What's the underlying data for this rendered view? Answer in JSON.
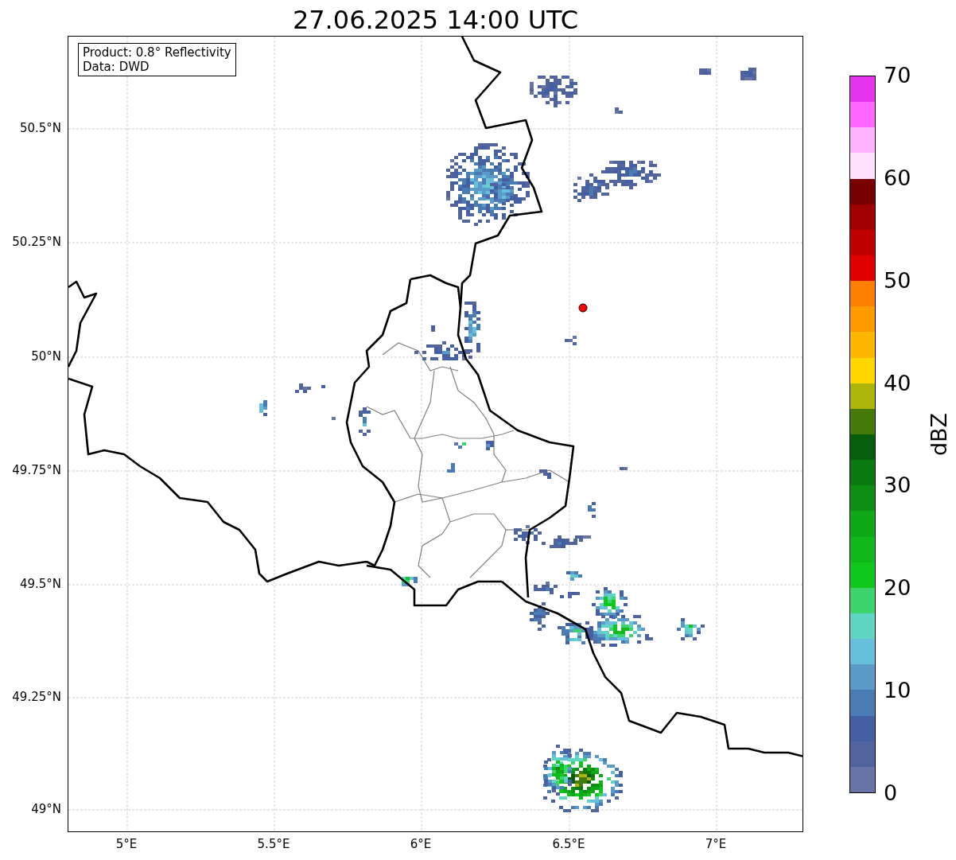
{
  "title": "27.06.2025 14:00 UTC",
  "info_box": [
    "Product: 0.8° Reflectivity",
    "Data: DWD"
  ],
  "map": {
    "lat_labels": [
      "50.5°N",
      "50.25°N",
      "50°N",
      "49.75°N",
      "49.5°N",
      "49.25°N",
      "49°N"
    ],
    "lon_labels": [
      "5°E",
      "5.5°E",
      "6°E",
      "6.5°E",
      "7°E"
    ]
  },
  "colorbar": {
    "label": "dBZ",
    "ticks": [
      "70",
      "60",
      "50",
      "40",
      "30",
      "20",
      "10",
      "0"
    ],
    "bands": [
      {
        "color": "#6674a8"
      },
      {
        "color": "#52649e"
      },
      {
        "color": "#4460a3"
      },
      {
        "color": "#4a7bb3"
      },
      {
        "color": "#5a9bc8"
      },
      {
        "color": "#66c0dc"
      },
      {
        "color": "#5fd6c4"
      },
      {
        "color": "#3dd46e"
      },
      {
        "color": "#10c81b"
      },
      {
        "color": "#10b81a"
      },
      {
        "color": "#0fa816"
      },
      {
        "color": "#0c8f12"
      },
      {
        "color": "#0a7a10"
      },
      {
        "color": "#075e0c"
      },
      {
        "color": "#457a0a"
      },
      {
        "color": "#adb40a"
      },
      {
        "color": "#ffd700"
      },
      {
        "color": "#ffb600"
      },
      {
        "color": "#ff9900"
      },
      {
        "color": "#ff7f00"
      },
      {
        "color": "#e00000"
      },
      {
        "color": "#c00000"
      },
      {
        "color": "#a00000"
      },
      {
        "color": "#780000"
      },
      {
        "color": "#ffe0ff"
      },
      {
        "color": "#ffb3ff"
      },
      {
        "color": "#ff66ff"
      },
      {
        "color": "#e633ee"
      }
    ]
  }
}
